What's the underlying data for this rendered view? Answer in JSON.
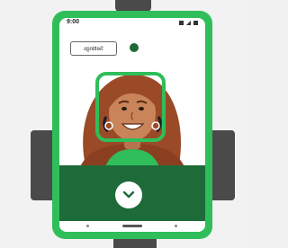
{
  "status_bar": {
    "time": "9:00",
    "icons": [
      "wifi-icon",
      "signal-icon",
      "battery-icon"
    ]
  },
  "toolbar": {
    "settings_label": "Settings"
  },
  "record_indicator": {
    "icon": "record-dot-icon",
    "color": "#1e6b3a"
  },
  "camera": {
    "frame_color": "#2fbe5a",
    "shutter_icon": "chevron-down-icon"
  },
  "colors": {
    "phone_body": "#2fbe5a",
    "panel": "#1e6b3a",
    "mount": "#4a4a4a"
  }
}
